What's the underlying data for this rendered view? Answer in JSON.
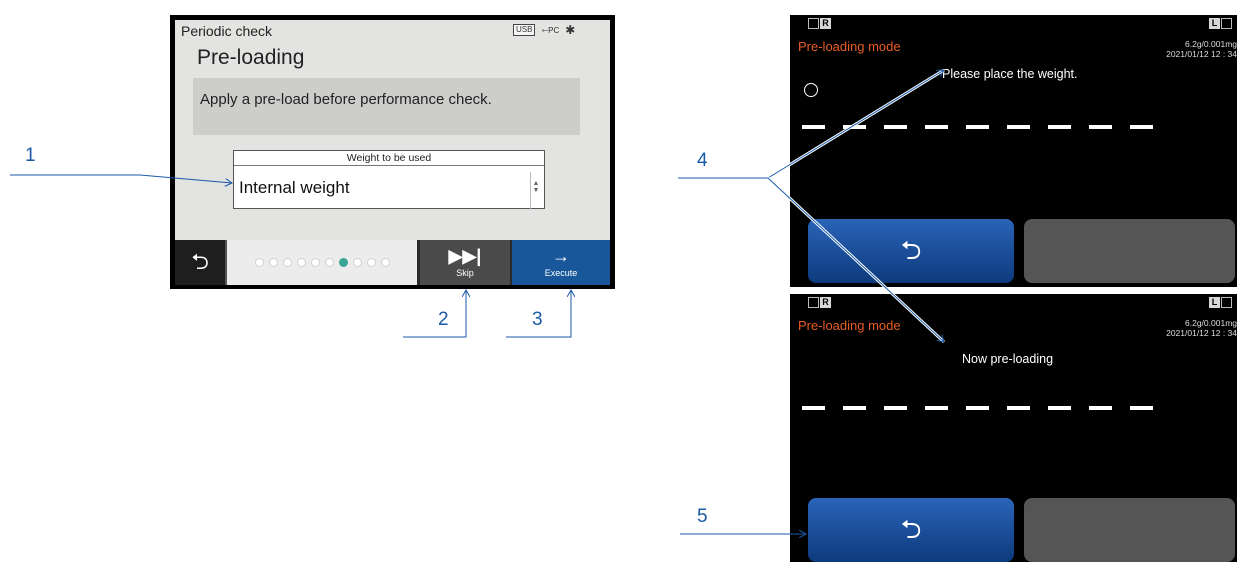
{
  "screen1": {
    "header_title": "Periodic check",
    "status_usb": "USB",
    "status_pc": "PC",
    "status_bt_icon": "bluetooth-icon",
    "title": "Pre-loading",
    "message": "Apply a pre-load before performance check.",
    "dropdown_label": "Weight to be used",
    "dropdown_value": "Internal weight",
    "progress": {
      "total": 10,
      "current": 7
    },
    "skip_label": "Skip",
    "execute_label": "Execute"
  },
  "screen2": {
    "tag_left": "R",
    "tag_right": "L",
    "mode_title": "Pre-loading mode",
    "capacity": "6.2g/0.001mg",
    "datetime": "2021/01/12   12 : 34",
    "message": "Please place the weight.",
    "dash_count": 9
  },
  "screen3": {
    "tag_left": "R",
    "tag_right": "L",
    "mode_title": "Pre-loading mode",
    "capacity": "6.2g/0.001mg",
    "datetime": "2021/01/12   12 : 34",
    "message": "Now pre-loading",
    "dash_count": 9
  },
  "callouts": [
    "1",
    "2",
    "3",
    "4",
    "5"
  ],
  "colors": {
    "accent_blue": "#19579b",
    "mode_orange": "#e85d23",
    "progress_active": "#3aa596",
    "callout": "#1a5aa8"
  }
}
